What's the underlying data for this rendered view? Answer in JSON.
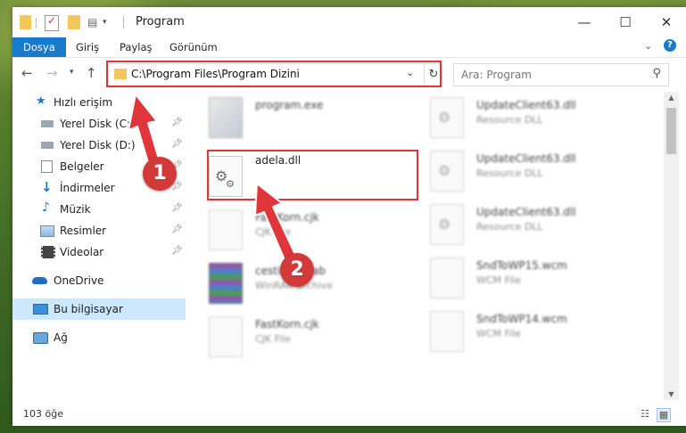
{
  "window": {
    "title": "Program",
    "controls": {
      "minimize": "—",
      "maximize": "☐",
      "close": "✕"
    }
  },
  "ribbon": {
    "tabs": [
      "Dosya",
      "Giriş",
      "Paylaş",
      "Görünüm"
    ],
    "expand_icon": "chevron-down-icon",
    "help_icon": "help-icon"
  },
  "address_bar": {
    "path": "C:\\Program Files\\Program Dizini",
    "dropdown": "⌄",
    "refresh": "↻"
  },
  "search": {
    "placeholder": "Ara: Program"
  },
  "sidebar": {
    "items": [
      {
        "label": "Hızlı erişim",
        "icon": "star-icon",
        "pinned": false
      },
      {
        "label": "Yerel Disk (C:)",
        "icon": "drive-icon",
        "pinned": true
      },
      {
        "label": "Yerel Disk (D:)",
        "icon": "drive-icon",
        "pinned": true
      },
      {
        "label": "Belgeler",
        "icon": "documents-icon",
        "pinned": true
      },
      {
        "label": "İndirmeler",
        "icon": "download-icon",
        "pinned": true
      },
      {
        "label": "Müzik",
        "icon": "music-icon",
        "pinned": true
      },
      {
        "label": "Resimler",
        "icon": "pictures-icon",
        "pinned": true
      },
      {
        "label": "Videolar",
        "icon": "video-icon",
        "pinned": true
      },
      {
        "label": "OneDrive",
        "icon": "cloud-icon",
        "pinned": false
      },
      {
        "label": "Bu bilgisayar",
        "icon": "computer-icon",
        "pinned": false,
        "selected": true
      },
      {
        "label": "Ağ",
        "icon": "network-icon",
        "pinned": false
      }
    ]
  },
  "files": [
    {
      "name": "program.exe",
      "type": ""
    },
    {
      "name": "adela.dll",
      "type": ""
    },
    {
      "name": "FastKorn.cjk",
      "type": "CJK File"
    },
    {
      "name": "cestimes.cab",
      "type": "WinRAR archive"
    },
    {
      "name": "FastKorn.cjk",
      "type": "CJK File"
    },
    {
      "name": "UpdateClient63.dll",
      "type": "Resource DLL"
    },
    {
      "name": "UpdateClient63.dll",
      "type": "Resource DLL"
    },
    {
      "name": "UpdateClient63.dll",
      "type": "Resource DLL"
    },
    {
      "name": "SndToWP15.wcm",
      "type": "WCM File"
    },
    {
      "name": "SndToWP14.wcm",
      "type": "WCM File"
    }
  ],
  "status": {
    "item_count": "103 öğe"
  },
  "annotations": {
    "step1": "1",
    "step2": "2"
  },
  "colors": {
    "accent": "#1979ca",
    "annotation": "#e0353b",
    "selected": "#cce8ff"
  }
}
